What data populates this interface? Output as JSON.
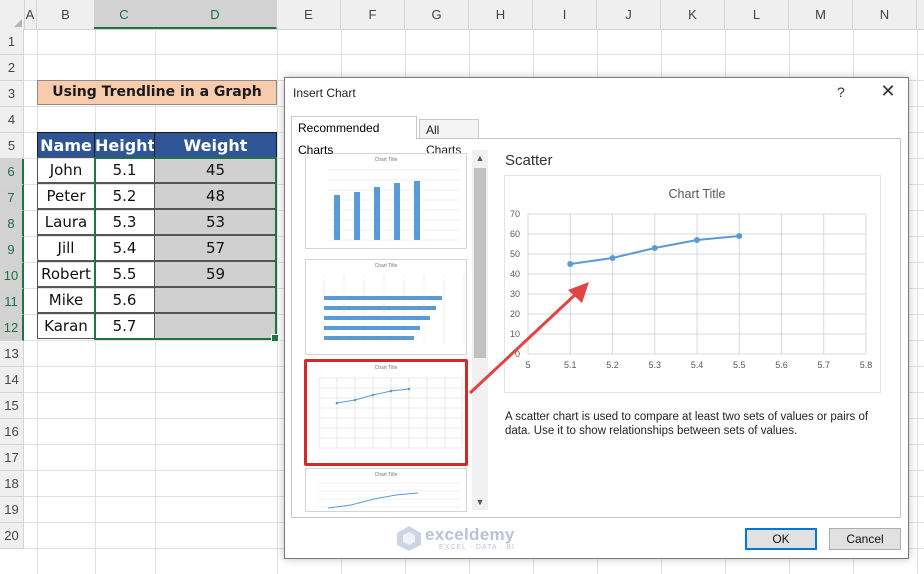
{
  "spreadsheet": {
    "columns": [
      "A",
      "B",
      "C",
      "D",
      "E",
      "F",
      "G",
      "H",
      "I",
      "J",
      "K",
      "L",
      "M",
      "N"
    ],
    "rows": [
      "1",
      "2",
      "3",
      "4",
      "5",
      "6",
      "7",
      "8",
      "9",
      "10",
      "11",
      "12",
      "13",
      "14",
      "15",
      "16",
      "17",
      "18",
      "19",
      "20"
    ],
    "title": "Using Trendline in a Graph",
    "table": {
      "headers": [
        "Name",
        "Height",
        "Weight"
      ],
      "rows": [
        {
          "name": "John",
          "height": "5.1",
          "weight": "45"
        },
        {
          "name": "Peter",
          "height": "5.2",
          "weight": "48"
        },
        {
          "name": "Laura",
          "height": "5.3",
          "weight": "53"
        },
        {
          "name": "Jill",
          "height": "5.4",
          "weight": "57"
        },
        {
          "name": "Robert",
          "height": "5.5",
          "weight": "59"
        },
        {
          "name": "Mike",
          "height": "5.6",
          "weight": ""
        },
        {
          "name": "Karan",
          "height": "5.7",
          "weight": ""
        }
      ]
    }
  },
  "dialog": {
    "title": "Insert Chart",
    "help": "?",
    "close": "✕",
    "tabs": [
      {
        "label": "Recommended Charts",
        "active": true
      },
      {
        "label": "All Charts",
        "active": false
      }
    ],
    "thumbnails": [
      {
        "type": "column",
        "title": "Chart Title",
        "selected": false
      },
      {
        "type": "bar",
        "title": "Chart Title",
        "selected": false
      },
      {
        "type": "scatter",
        "title": "Chart Title",
        "selected": true
      },
      {
        "type": "line",
        "title": "Chart Title",
        "selected": false
      }
    ],
    "preview": {
      "name": "Scatter",
      "description": "A scatter chart is used to compare at least two sets of values or pairs of data. Use it to show relationships between sets of values."
    },
    "buttons": {
      "ok": "OK",
      "cancel": "Cancel"
    },
    "scroll": {
      "up": "▲",
      "down": "▼"
    }
  },
  "watermark": {
    "text": "exceldemy",
    "sub": "EXCEL · DATA · BI"
  },
  "colors": {
    "accent": "#217346",
    "header_fill": "#2f5597",
    "title_fill": "#f8cbad",
    "series": "#5b9bd5",
    "highlight": "#d12a2a"
  },
  "chart_data": {
    "type": "scatter",
    "title": "Chart Title",
    "x": [
      5.1,
      5.2,
      5.3,
      5.4,
      5.5
    ],
    "y": [
      45,
      48,
      53,
      57,
      59
    ],
    "xlim": [
      5,
      5.8
    ],
    "ylim": [
      0,
      70
    ],
    "xticks": [
      "5",
      "5.1",
      "5.2",
      "5.3",
      "5.4",
      "5.5",
      "5.6",
      "5.7",
      "5.8"
    ],
    "yticks": [
      "0",
      "10",
      "20",
      "30",
      "40",
      "50",
      "60",
      "70"
    ],
    "grid": true
  }
}
